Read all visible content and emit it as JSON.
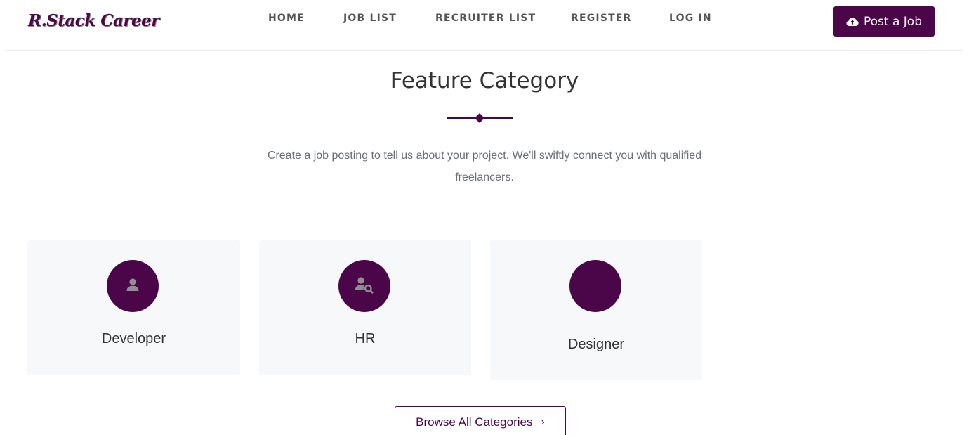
{
  "header": {
    "logo": "R.Stack Career",
    "nav": {
      "home": "HOME",
      "job_list": "JOB LIST",
      "recruiter_list": "RECRUITER LIST",
      "register": "REGISTER",
      "login": "LOG IN"
    },
    "post_job_label": "Post a Job",
    "post_job_icon": "cloud-upload-icon"
  },
  "section": {
    "title": "Feature Category",
    "description": "Create a job posting to tell us about your project. We'll swiftly connect you with qualified freelancers."
  },
  "categories": [
    {
      "label": "Developer",
      "icon": "user-icon"
    },
    {
      "label": "HR",
      "icon": "user-search-icon"
    },
    {
      "label": "Designer",
      "icon": ""
    }
  ],
  "browse": {
    "label": "Browse All Categories",
    "chevron": "›"
  },
  "colors": {
    "brand": "#4a0649",
    "card_bg": "#f7f8f9",
    "icon_gray": "#8e8e93",
    "text_muted": "#6b6f76"
  }
}
